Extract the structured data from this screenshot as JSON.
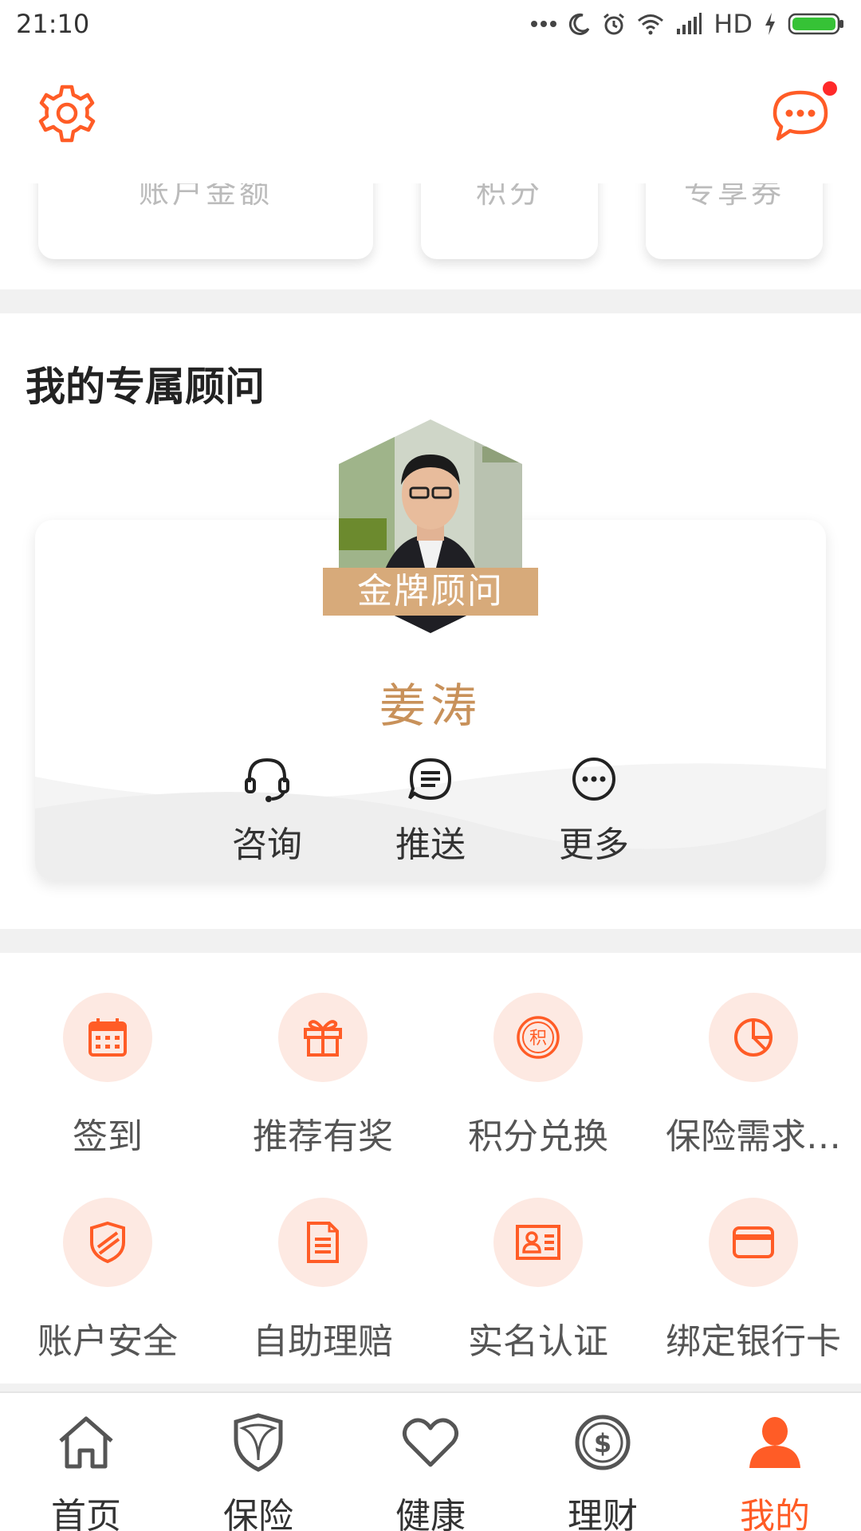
{
  "status_bar": {
    "time": "21:10",
    "network": "HD"
  },
  "header": {
    "settings_icon": "gear-icon",
    "message_icon": "chat-icon",
    "has_unread": true
  },
  "top_cards": [
    {
      "label": "账户金额"
    },
    {
      "label": "积分"
    },
    {
      "label": "专享券"
    }
  ],
  "advisor_section": {
    "title": "我的专属顾问",
    "badge": "金牌顾问",
    "name": "姜涛",
    "actions": [
      {
        "label": "咨询",
        "icon": "headset-icon"
      },
      {
        "label": "推送",
        "icon": "chat-bubble-icon"
      },
      {
        "label": "更多",
        "icon": "more-icon"
      }
    ]
  },
  "grid": [
    {
      "label": "签到",
      "icon": "calendar-icon"
    },
    {
      "label": "推荐有奖",
      "icon": "gift-icon"
    },
    {
      "label": "积分兑换",
      "icon": "points-icon",
      "icon_text": "积"
    },
    {
      "label": "保险需求…",
      "icon": "pie-chart-icon"
    },
    {
      "label": "账户安全",
      "icon": "shield-icon"
    },
    {
      "label": "自助理赔",
      "icon": "document-icon"
    },
    {
      "label": "实名认证",
      "icon": "id-card-icon"
    },
    {
      "label": "绑定银行卡",
      "icon": "bank-card-icon"
    }
  ],
  "bottom_nav": [
    {
      "label": "首页",
      "icon": "home-icon",
      "active": false
    },
    {
      "label": "保险",
      "icon": "shield-icon",
      "active": false
    },
    {
      "label": "健康",
      "icon": "heart-icon",
      "active": false
    },
    {
      "label": "理财",
      "icon": "dollar-coin-icon",
      "active": false
    },
    {
      "label": "我的",
      "icon": "user-icon",
      "active": true
    }
  ],
  "colors": {
    "accent": "#ff5c26",
    "badge": "#d7aa7a",
    "name": "#c8915a",
    "icon_bg": "#fde9e2"
  }
}
